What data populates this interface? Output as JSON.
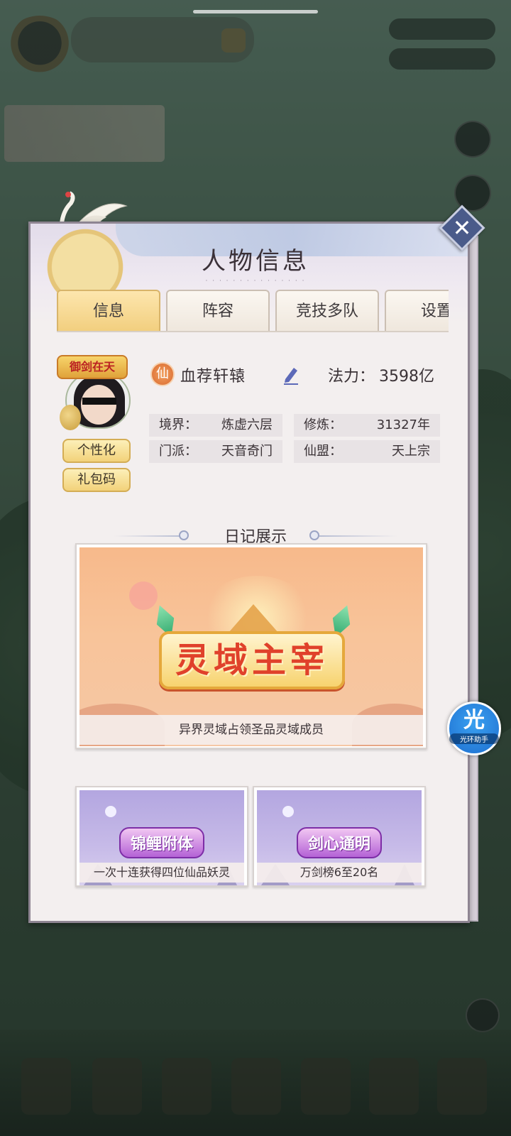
{
  "panel": {
    "title": "人物信息",
    "close_symbol": "✕"
  },
  "tabs": [
    {
      "label": "信息",
      "active": true
    },
    {
      "label": "阵容",
      "active": false
    },
    {
      "label": "竞技多队",
      "active": false
    },
    {
      "label": "设置",
      "active": false
    }
  ],
  "profile": {
    "avatar_frame_text": "御剑在天",
    "realm_badge": "仙",
    "name": "血荐轩辕",
    "power_label": "法力：",
    "power_value": "3598亿",
    "buttons": {
      "personalize": "个性化",
      "gift_code": "礼包码"
    },
    "stats": [
      {
        "key": "境界：",
        "value": "炼虚六层"
      },
      {
        "key": "修炼：",
        "value": "31327年"
      },
      {
        "key": "门派：",
        "value": "天音奇门"
      },
      {
        "key": "仙盟：",
        "value": "天上宗"
      }
    ]
  },
  "diary": {
    "title": "日记展示",
    "featured": {
      "badge": "灵域主宰",
      "caption": "异界灵域占领圣品灵域成员"
    },
    "cards": [
      {
        "badge": "锦鲤附体",
        "caption": "一次十连获得四位仙品妖灵"
      },
      {
        "badge": "剑心通明",
        "caption": "万剑榜6至20名"
      }
    ]
  },
  "helper": {
    "icon_char": "光",
    "label": "光环助手"
  },
  "colors": {
    "active_tab": "#f2cf7f",
    "close_button": "#4a5b8a",
    "helper": "#1e6fd0"
  }
}
